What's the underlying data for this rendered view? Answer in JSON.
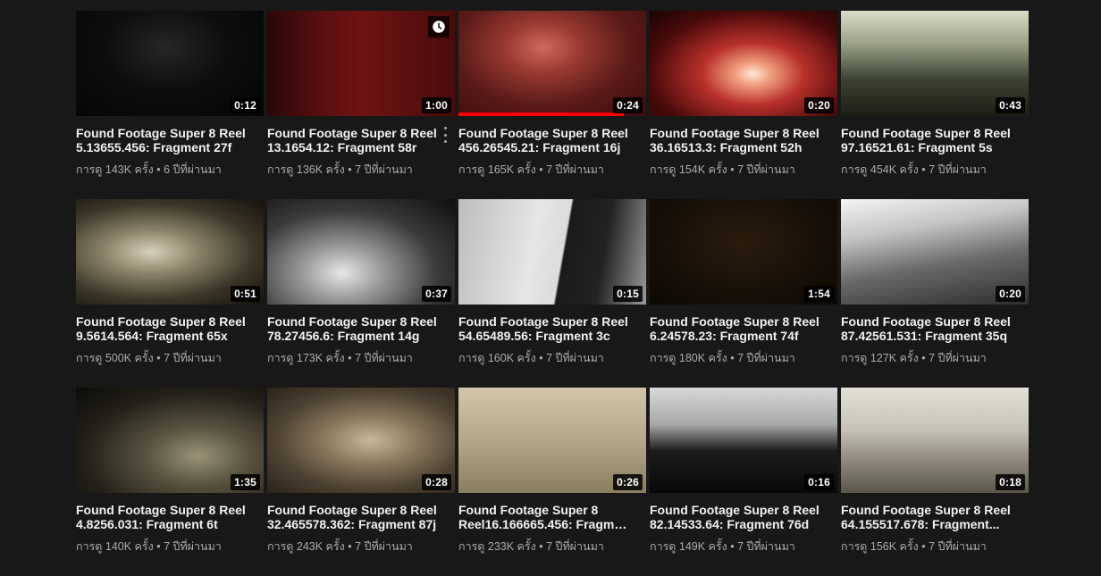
{
  "videos": [
    {
      "title": "Found Footage Super 8 Reel 5.13655.456: Fragment 27f",
      "views": "การดู 143K ครั้ง",
      "age": "6 ปีที่ผ่านมา",
      "duration": "0:12",
      "bg": "radial-gradient(ellipse at 48% 35%, #262626 0%, #0d0d0d 45%, #050505 100%)"
    },
    {
      "title": "Found Footage Super 8 Reel 13.1654.12: Fragment 58r",
      "views": "การดู 136K ครั้ง",
      "age": "7 ปีที่ผ่านมา",
      "duration": "1:00",
      "bg": "linear-gradient(90deg, #2a0708 0%, #5a0f10 30%, #6e1312 50%, #4a0b0b 100%)",
      "watch_later": true,
      "menu": true
    },
    {
      "title": "Found Footage Super 8 Reel 456.26545.21: Fragment 16j",
      "views": "การดู 165K ครั้ง",
      "age": "7 ปีที่ผ่านมา",
      "duration": "0:24",
      "bg": "radial-gradient(ellipse at 45% 35%, #d06a5a 0%, #9a3b32 25%, #5a1a18 60%, #3a0d0d 100%)",
      "progress": 0.88
    },
    {
      "title": "Found Footage Super 8 Reel 36.16513.3: Fragment 52h",
      "views": "การดู 154K ครั้ง",
      "age": "7 ปีที่ผ่านมา",
      "duration": "0:20",
      "bg": "radial-gradient(ellipse at 55% 60%, #ffe8d8 0%, #f2a080 12%, #b8302a 35%, #4a0a0a 70%, #1a0404 100%)"
    },
    {
      "title": "Found Footage Super 8 Reel 97.16521.61: Fragment 5s",
      "views": "การดู 454K ครั้ง",
      "age": "7 ปีที่ผ่านมา",
      "duration": "0:43",
      "bg": "linear-gradient(180deg, #d9dcc8 0%, #9ea58a 30%, #3d4232 65%, #1b1e15 100%)"
    },
    {
      "title": "Found Footage Super 8 Reel 9.5614.564: Fragment 65x",
      "views": "การดู 500K ครั้ง",
      "age": "7 ปีที่ผ่านมา",
      "duration": "0:51",
      "bg": "radial-gradient(ellipse at 40% 50%, #d6d0b8 0%, #8a8268 30%, #3a3526 65%, #15120c 100%)"
    },
    {
      "title": "Found Footage Super 8 Reel 78.27456.6: Fragment 14g",
      "views": "การดู 173K ครั้ง",
      "age": "7 ปีที่ผ่านมา",
      "duration": "0:37",
      "bg": "radial-gradient(ellipse at 40% 70%, #e8e8e8 0%, #9a9a9a 25%, #3a3a3a 60%, #0e0e0e 100%)"
    },
    {
      "title": "Found Footage Super 8 Reel 54.65489.56: Fragment 3c",
      "views": "การดู 160K ครั้ง",
      "age": "7 ปีที่ผ่านมา",
      "duration": "0:15",
      "bg": "linear-gradient(100deg, #bdbdbd 0%, #e6e6e6 40%, #dcdcdc 55%, #1a1a1a 56%, #222 75%, #9a9a9a 100%)"
    },
    {
      "title": "Found Footage Super 8 Reel 6.24578.23: Fragment 74f",
      "views": "การดู 180K ครั้ง",
      "age": "7 ปีที่ผ่านมา",
      "duration": "1:54",
      "bg": "radial-gradient(ellipse at 50% 40%, #2a1c0c 0%, #1a1108 50%, #0c0804 100%)"
    },
    {
      "title": "Found Footage Super 8 Reel 87.42561.531: Fragment 35q",
      "views": "การดู 127K ครั้ง",
      "age": "7 ปีที่ผ่านมา",
      "duration": "0:20",
      "bg": "linear-gradient(170deg, #f4f4f4 0%, #c4c4c4 30%, #6a6a6a 60%, #2e2e2e 100%)"
    },
    {
      "title": "Found Footage Super 8 Reel 4.8256.031: Fragment 6t",
      "views": "การดู 140K ครั้ง",
      "age": "7 ปีที่ผ่านมา",
      "duration": "1:35",
      "bg": "radial-gradient(ellipse at 65% 65%, #9a9378 0%, #58533f 30%, #24211a 65%, #0c0b08 100%)"
    },
    {
      "title": "Found Footage Super 8 Reel 32.465578.362: Fragment 87j",
      "views": "การดู 243K ครั้ง",
      "age": "7 ปีที่ผ่านมา",
      "duration": "0:28",
      "bg": "radial-gradient(ellipse at 55% 50%, #c8b89a 0%, #8e7c60 30%, #4e4232 65%, #2a2218 100%)"
    },
    {
      "title": "Found Footage Super 8 Reel16.166665.456: Fragment ...",
      "views": "การดู 233K ครั้ง",
      "age": "7 ปีที่ผ่านมา",
      "duration": "0:26",
      "bg": "linear-gradient(180deg, #d2c6aa 0%, #b4a888 50%, #8a7e62 100%)"
    },
    {
      "title": "Found Footage Super 8 Reel 82.14533.64: Fragment 76d",
      "views": "การดู 149K ครั้ง",
      "age": "7 ปีที่ผ่านมา",
      "duration": "0:16",
      "bg": "linear-gradient(180deg, #d8d8d8 0%, #a8a8a8 35%, #1c1c1c 60%, #080808 100%)"
    },
    {
      "title": "Found Footage Super 8 Reel 64.155517.678: Fragment...",
      "views": "การดู 156K ครั้ง",
      "age": "7 ปีที่ผ่านมา",
      "duration": "0:18",
      "bg": "linear-gradient(180deg, #e4e1d8 0%, #c6c2b6 40%, #8c877a 70%, #5a564c 100%)"
    }
  ]
}
